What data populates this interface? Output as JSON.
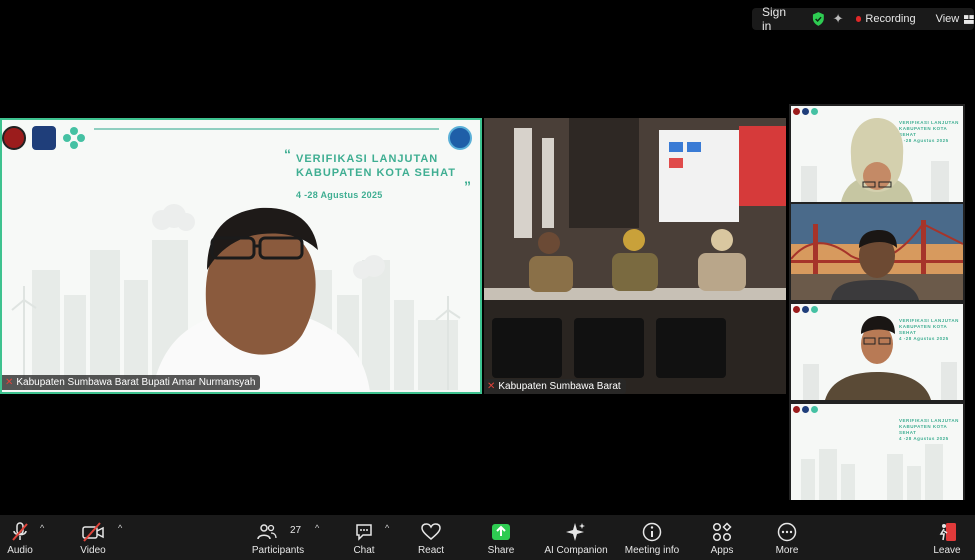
{
  "topbar": {
    "signin": "Sign in",
    "recording": "Recording",
    "view": "View",
    "shield_color": "#2ecc52",
    "rec_color": "#e02828"
  },
  "tiles": {
    "main": {
      "name": "Kabupaten Sumbawa Barat Bupati Amar Nurmansyah",
      "slide_title_1": "VERIFIKASI LANJUTAN",
      "slide_title_2": "KABUPATEN KOTA SEHAT",
      "slide_date": "4 -28 Agustus 2025",
      "accent": "#3fae92",
      "active_border": "#3ec28f"
    },
    "room": {
      "name": "Kabupaten Sumbawa Barat"
    },
    "side": [
      {
        "title_1": "VERIFIKASI LANJUTAN",
        "title_2": "KABUPATEN KOTA SEHAT",
        "date": "4 -28 Agustus 2025"
      },
      {},
      {
        "title_1": "VERIFIKASI LANJUTAN",
        "title_2": "KABUPATEN KOTA SEHAT",
        "date": "4 -28 Agustus 2025"
      },
      {
        "title_1": "VERIFIKASI LANJUTAN",
        "title_2": "KABUPATEN KOTA SEHAT",
        "date": "4 -28 Agustus 2025"
      }
    ]
  },
  "toolbar": {
    "audio": "Audio",
    "video": "Video",
    "participants": "Participants",
    "participants_count": "27",
    "chat": "Chat",
    "react": "React",
    "share": "Share",
    "ai_companion": "AI Companion",
    "meeting_info": "Meeting info",
    "apps": "Apps",
    "more": "More",
    "leave": "Leave",
    "share_color": "#2ecc52",
    "leave_color": "#e03a3a",
    "off_color": "#e0433a"
  }
}
